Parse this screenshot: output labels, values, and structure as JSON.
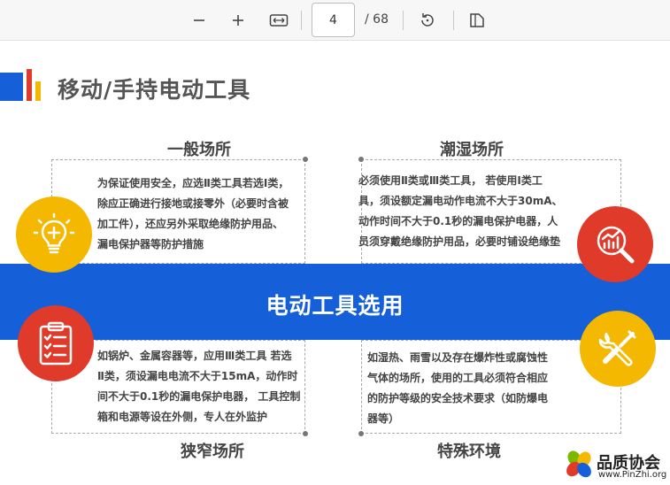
{
  "toolbar": {
    "zoom_out_icon": "minus-icon",
    "zoom_in_icon": "plus-icon",
    "fit_icon": "fit-width-icon",
    "page_current": "4",
    "page_total": "/ 68",
    "rotate_icon": "rotate-icon",
    "view_icon": "page-view-icon"
  },
  "slide": {
    "title": "移动/手持电动工具",
    "center_band": "电动工具选用",
    "general": {
      "title": "一般场所",
      "lines": [
        "为保证使用安全，应选Ⅱ类工具若选Ⅰ类，",
        "除应正确进行接地或接零外（必要时含被",
        "加工件），还应另外采取绝缘防护用品、",
        "漏电保护器等防护措施"
      ],
      "icon": "lightbulb-plus-icon"
    },
    "humid": {
      "title": "潮湿场所",
      "lines": [
        "必须使用Ⅱ类或Ⅲ类工具，  若使用Ⅰ类工",
        "具，须设额定漏电动作电流不大于30mA、",
        "动作时间不大于0.1秒的漏电保护电器，人",
        "员须穿戴绝缘防护用品，必要时铺设绝缘垫"
      ],
      "icon": "chart-magnifier-icon"
    },
    "narrow": {
      "title": "狭窄场所",
      "lines": [
        "如锅炉、金属容器等，应用Ⅲ类工具  若选",
        "Ⅱ类，须设漏电电流不大于15mA，动作时",
        "间不大于0.1秒的漏电保护电器，  工具控制",
        "箱和电源等设在外侧，专人在外监护"
      ],
      "icon": "checklist-icon"
    },
    "special": {
      "title": "特殊环境",
      "lines": [
        "如湿热、雨雪以及存在爆炸性或腐蚀性",
        "气体的场所，使用的工具必须符合相应",
        "的防护等级的安全技术要求（如防爆电",
        "器等）"
      ],
      "icon": "wrench-screwdriver-icon"
    }
  },
  "watermark": {
    "name": "品质协会",
    "url": "www.PinZhi.org"
  },
  "colors": {
    "blue": "#1560d8",
    "red": "#e03a2b",
    "yellow": "#f5b800"
  }
}
